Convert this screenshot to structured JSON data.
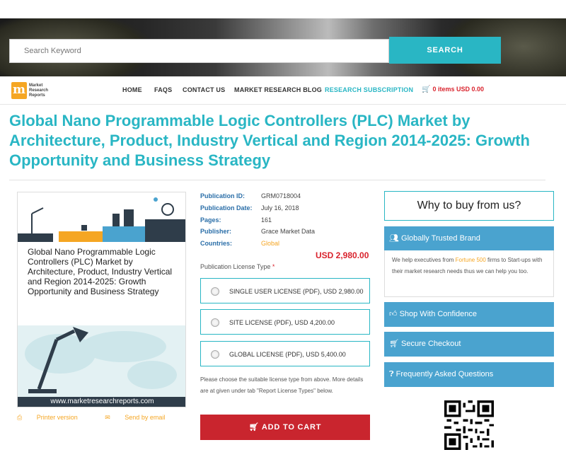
{
  "search": {
    "placeholder": "Search Keyword",
    "button_label": "SEARCH"
  },
  "logo": {
    "letter": "m",
    "line1": "Market",
    "line2": "Research",
    "line3": "Reports"
  },
  "nav": {
    "items": [
      "HOME",
      "FAQS",
      "CONTACT US",
      "MARKET RESEARCH BLOG",
      "RESEARCH SUBSCRIPTION"
    ],
    "cart": "0 items USD 0.00"
  },
  "title": "Global Nano Programmable Logic Controllers (PLC) Market by Architecture, Product, Industry Vertical and Region 2014-2025: Growth Opportunity and Business Strategy",
  "cover": {
    "text": "Global Nano Programmable Logic Controllers (PLC) Market by Architecture, Product, Industry Vertical and Region 2014-2025: Growth Opportunity and Business Strategy",
    "url": "www.marketresearchreports.com"
  },
  "cover_links": {
    "printer": "Printer version",
    "email": "Send by email"
  },
  "meta": {
    "publication_id_label": "Publication ID:",
    "publication_id": "GRM0718004",
    "publication_date_label": "Publication Date:",
    "publication_date": "July 16, 2018",
    "pages_label": "Pages:",
    "pages": "161",
    "publisher_label": "Publisher:",
    "publisher": "Grace Market Data",
    "countries_label": "Countries:",
    "countries": "Global"
  },
  "price": "USD 2,980.00",
  "license": {
    "label": "Publication License Type",
    "required_mark": "*",
    "options": [
      "SINGLE USER LICENSE (PDF), USD 2,980.00",
      "SITE LICENSE (PDF), USD 4,200.00",
      "GLOBAL LICENSE (PDF), USD 5,400.00"
    ],
    "note": "Please choose the suitable license type from above. More details are at given under tab \"Report License Types\" below."
  },
  "add_to_cart": "ADD TO CART",
  "sidebar": {
    "why_title": "Why to buy from us?",
    "globally_trusted": "Globally Trusted Brand",
    "trusted_text_1": "We help executives from ",
    "trusted_highlight": "Fortune 500",
    "trusted_text_2": " firms to Start-ups with their market research needs thus we can help you too.",
    "shop": "Shop With Confidence",
    "checkout": "Secure Checkout",
    "faq": "Frequently Asked Questions"
  },
  "colors": {
    "accent": "#29b6c4",
    "brand_orange": "#f5a623",
    "price_red": "#d9232d",
    "panel_blue": "#4aa3cf"
  }
}
